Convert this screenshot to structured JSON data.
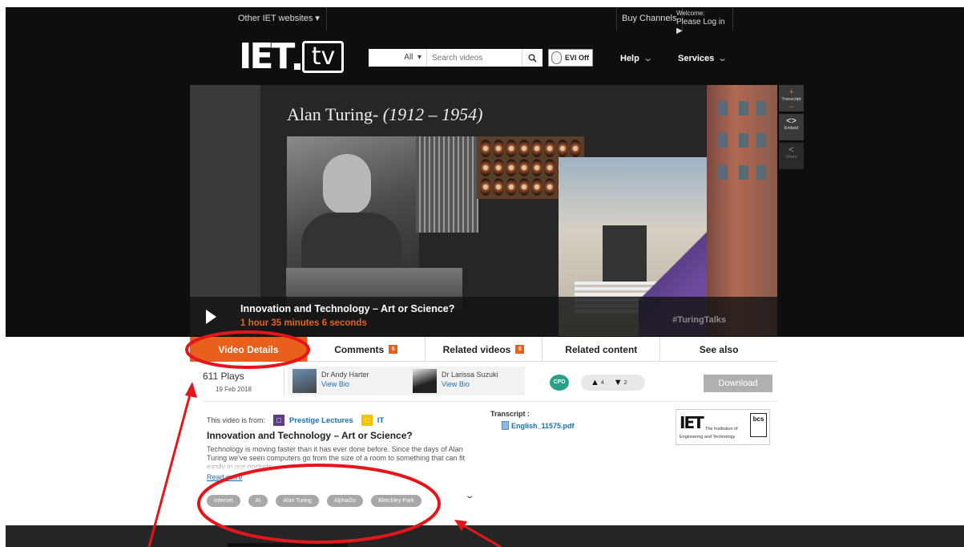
{
  "utilbar": {
    "other_sites": "Other IET websites",
    "buy_channels": "Buy Channels",
    "welcome": "Welcome:",
    "login": "Please Log in ▶"
  },
  "logo": {
    "iet": "IET",
    "tv": "tv"
  },
  "search": {
    "scope": "All",
    "placeholder": "Search videos"
  },
  "evi": {
    "label": "EVI Off"
  },
  "nav": {
    "help": "Help",
    "services": "Services"
  },
  "video": {
    "slide_title_name": "Alan Turing- ",
    "slide_title_years": "(1912 – 1954)",
    "name": "Innovation and Technology – Art or Science?",
    "duration": "1 hour 35 minutes 6 seconds",
    "hashtag": "#TuringTalks"
  },
  "side_buttons": {
    "transcript": "Transcript",
    "embed": "Embed",
    "share": "Share"
  },
  "tabs": [
    {
      "label": "Video Details",
      "count": ""
    },
    {
      "label": "Comments",
      "count": "6"
    },
    {
      "label": "Related videos",
      "count": "8"
    },
    {
      "label": "Related content",
      "count": ""
    },
    {
      "label": "See also",
      "count": ""
    }
  ],
  "stats": {
    "plays": "611 Plays",
    "date": "19 Feb 2018"
  },
  "speakers": [
    {
      "name": "Dr Andy Harter",
      "bio": "View Bio"
    },
    {
      "name": "Dr Larissa Suzuki",
      "bio": "View Bio"
    }
  ],
  "badges": {
    "cpd": "CPD",
    "likes": "4",
    "dislikes": "2"
  },
  "download": "Download",
  "info": {
    "from_label": "This video is from:",
    "channel": "Prestige Lectures",
    "topic": "IT",
    "title": "Innovation and Technology – Art or Science?",
    "description": "Technology is moving faster than it has ever done before. Since the days of Alan Turing we've seen computers go from the size of a room to something that can fit easily in our pockets.",
    "read_more": "Read more",
    "tags": [
      "Internet",
      "AI",
      "Alan Turing",
      "AlphaGo",
      "Bletchley Park"
    ]
  },
  "transcript": {
    "label": "Transcript :",
    "file": "English_11575.pdf"
  },
  "partner": {
    "iet": "IET",
    "institution": "The Institution of",
    "engineering": "Engineering and Technology",
    "bcs": "bcs"
  },
  "colors": {
    "accent": "#e8601c",
    "link": "#1a6fb5",
    "annotation": "#e5161b"
  }
}
